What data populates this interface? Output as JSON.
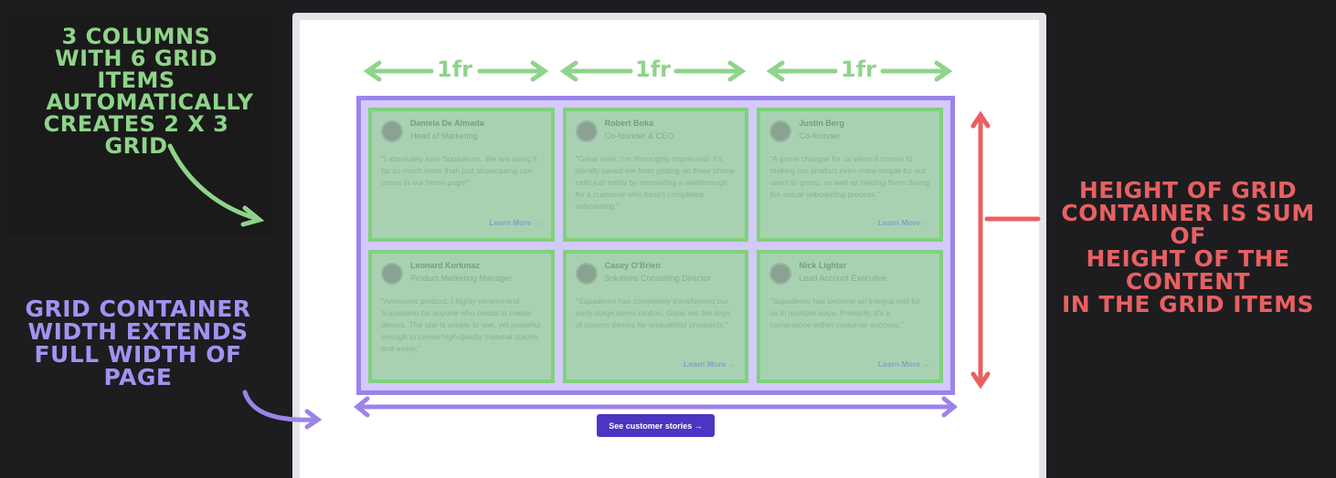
{
  "notes": {
    "green": [
      "3 columns",
      "with 6 grid items",
      "automatically",
      "creates 2 x 3 grid"
    ],
    "purple": [
      "grid container",
      "width extends",
      "full width of page"
    ],
    "red": [
      "height of grid",
      "container is sum of",
      "height of the content",
      "in the grid items"
    ]
  },
  "fr_labels": [
    "1fr",
    "1fr",
    "1fr"
  ],
  "cards": [
    {
      "name": "Daniela De Almada",
      "role": "Head of Marketing",
      "quote": "\"I absolutely love Supademo. We are using it for so much more than just showcasing use cases in our home page!\"",
      "link": "Learn More →"
    },
    {
      "name": "Robert Boka",
      "role": "Co-founder & CEO",
      "quote": "\"Great work, I'm thoroughly impressed. It's literally saved me from getting on three phone calls just today by annotating a walkthrough for a customer who hasn't completed onboarding.\"",
      "link": ""
    },
    {
      "name": "Justin Berg",
      "role": "Co-founder",
      "quote": "\"A game changer for us when it comes to making our product even more simple for our users to grasp, as well as helping them during the actual onboarding process.\"",
      "link": "Learn More →"
    },
    {
      "name": "Leonard Korkmaz",
      "role": "Product Marketing Manager",
      "quote": "\"Awesome product. I highly recommend Supademo for anyone who needs to create demos. The app is simple to use, yet powerful enough to create high-quality material quickly and easily.\"",
      "link": ""
    },
    {
      "name": "Casey O'Brien",
      "role": "Solutions Consulting Director",
      "quote": "\"Supademo has completely transformed our early-stage demo motion. Gone are the days of custom demos for unqualified prospects.\"",
      "link": "Learn More →"
    },
    {
      "name": "Nick Lighter",
      "role": "Lead Account Executive",
      "quote": "\"Supademo has become an integral tool for us in multiple ways. Primarily, it's a cornerstone within customer success.\"",
      "link": "Learn More →"
    }
  ],
  "cta": "See customer stories →",
  "colors": {
    "green": "#8fd48a",
    "purple": "#9c83ea",
    "red": "#e86062",
    "cta": "#4a35c4"
  }
}
